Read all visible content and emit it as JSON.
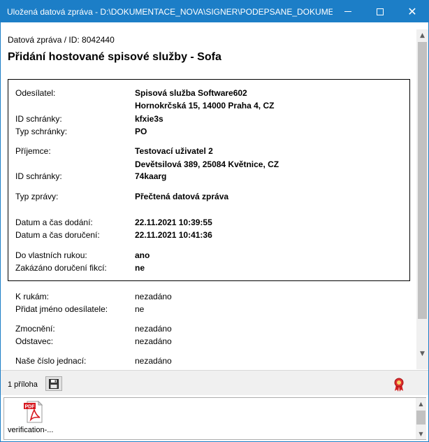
{
  "window": {
    "title": "Uložená datová zpráva - D:\\DOKUMENTACE_NOVA\\SIGNER\\PODEPSANE_DOKUMENT...",
    "titlebar_color": "#1c7ec7"
  },
  "message": {
    "meta": "Datová zpráva / ID: 8042440",
    "subject": "Přidání hostované spisové služby - Sofa"
  },
  "details": {
    "sender_label": "Odesílatel:",
    "sender_name": "Spisová služba Software602",
    "sender_address": "Hornokrčská 15, 14000 Praha 4, CZ",
    "sender_box_id_label": "ID schránky:",
    "sender_box_id": "kfxie3s",
    "box_type_label": "Typ schránky:",
    "box_type": "PO",
    "recipient_label": "Příjemce:",
    "recipient_name": "Testovací uživatel 2",
    "recipient_address": "Devětsilová 389, 25084 Květnice, CZ",
    "recipient_box_id_label": "ID schránky:",
    "recipient_box_id": "74kaarg",
    "message_type_label": "Typ zprávy:",
    "message_type": "Přečtená datová zpráva",
    "delivered_label": "Datum a čas dodání:",
    "delivered": "22.11.2021 10:39:55",
    "received_label": "Datum a čas doručení:",
    "received": "22.11.2021 10:41:36",
    "personal_label": "Do vlastních rukou:",
    "personal": "ano",
    "fiction_label": "Zakázáno doručení fikcí:",
    "fiction": "ne"
  },
  "extra": {
    "to_hands_label": "K rukám:",
    "to_hands": "nezadáno",
    "add_sender_name_label": "Přidat jméno odesílatele:",
    "add_sender_name": "ne",
    "authorization_label": "Zmocnění:",
    "authorization": "nezadáno",
    "paragraph_label": "Odstavec:",
    "paragraph": "nezadáno",
    "our_ref_label": "Naše číslo jednací:",
    "our_ref": "nezadáno"
  },
  "attachments": {
    "count_label": "1 příloha",
    "save_icon": "floppy-disk-icon",
    "seal_icon": "award-ribbon-icon",
    "files": [
      {
        "name": "verification-...",
        "icon": "pdf-file-icon",
        "badge": "PDF"
      }
    ]
  }
}
